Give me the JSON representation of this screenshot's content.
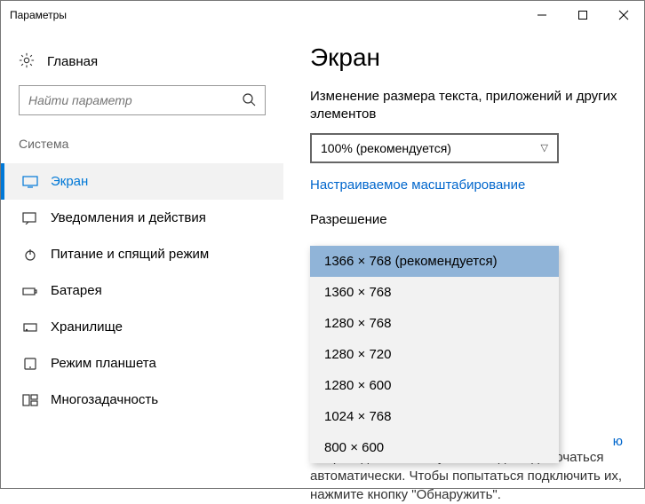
{
  "window": {
    "title": "Параметры"
  },
  "sidebar": {
    "home": "Главная",
    "search_placeholder": "Найти параметр",
    "section_label": "Система",
    "items": [
      {
        "label": "Экран"
      },
      {
        "label": "Уведомления и действия"
      },
      {
        "label": "Питание и спящий режим"
      },
      {
        "label": "Батарея"
      },
      {
        "label": "Хранилище"
      },
      {
        "label": "Режим планшета"
      },
      {
        "label": "Многозадачность"
      }
    ]
  },
  "main": {
    "title": "Экран",
    "scale_label": "Изменение размера текста, приложений и других элементов",
    "scale_value": "100% (рекомендуется)",
    "custom_scaling_link": "Настраиваемое масштабирование",
    "resolution_label": "Разрешение",
    "resolution_options": [
      "1366 × 768 (рекомендуется)",
      "1360 × 768",
      "1280 × 768",
      "1280 × 720",
      "1280 × 600",
      "1024 × 768",
      "800 × 600"
    ],
    "partial_link_suffix": "ю",
    "footer_text": "Старые дисплеи могут не всегда подключаться автоматически. Чтобы попытаться подключить их, нажмите кнопку \"Обнаружить\"."
  }
}
